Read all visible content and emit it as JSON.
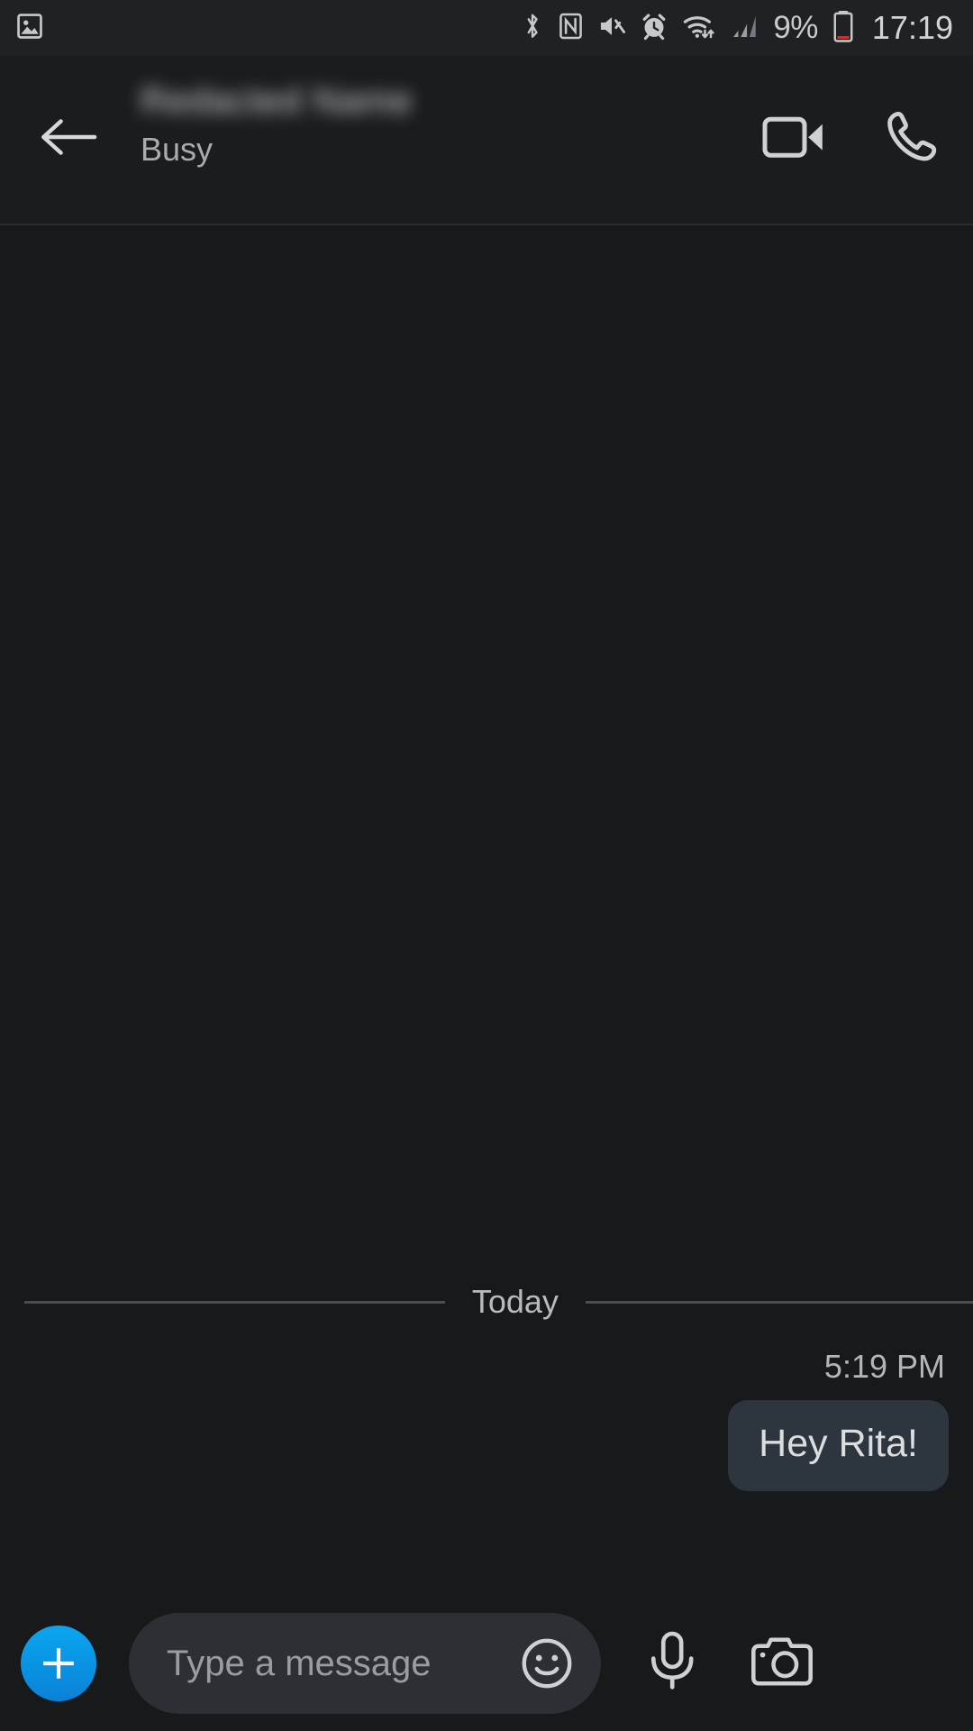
{
  "status_bar": {
    "left_icons": [
      {
        "name": "gallery-image-icon",
        "label": "image"
      }
    ],
    "right_icons": [
      {
        "name": "bluetooth-icon",
        "label": "bluetooth"
      },
      {
        "name": "nfc-icon",
        "label": "nfc"
      },
      {
        "name": "mute-icon",
        "label": "sound off"
      },
      {
        "name": "alarm-icon",
        "label": "alarm"
      },
      {
        "name": "wifi-icon",
        "label": "wifi"
      },
      {
        "name": "cellular-signal-icon",
        "label": "signal"
      }
    ],
    "battery_percent": "9%",
    "clock": "17:19",
    "battery_low_color": "#c3362b"
  },
  "header": {
    "back_label": "Back",
    "contact_name": "Redacted Name",
    "contact_status": "Busy",
    "video_call_label": "Video call",
    "voice_call_label": "Call"
  },
  "thread": {
    "day_divider_label": "Today",
    "messages": [
      {
        "time": "5:19 PM",
        "text": "Hey Rita!",
        "outgoing": true,
        "bubble_color": "#2d363f"
      }
    ]
  },
  "composer": {
    "attach_label": "Add attachment",
    "input_placeholder": "Type a message",
    "input_value": "",
    "emoji_label": "Emoji",
    "mic_label": "Voice message",
    "camera_label": "Camera",
    "accent_color": "#0a96e6"
  }
}
